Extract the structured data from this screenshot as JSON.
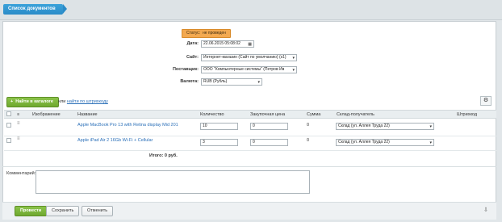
{
  "header": {
    "doc_list_tab": "Список документов"
  },
  "form": {
    "status_label": "Статус:",
    "status_value": "не проведен",
    "date_label": "Дата:",
    "date_value": "22.06.2015 05:08:02",
    "site_label": "Сайт:",
    "site_value": "Интернет-магазин (Сайт по умолчанию) (s1)",
    "supplier_label": "Поставщик:",
    "supplier_value": "ООО \"Компьютерные системы\" (Петров Ив",
    "currency_label": "Валюта:",
    "currency_value": "RUB (Рубль)"
  },
  "toolbar": {
    "find_catalog_label": "Найти в каталоге",
    "or_label": "или",
    "barcode_link": "найти по штрихкоду"
  },
  "table": {
    "columns": [
      "Изображение",
      "Название",
      "Количество",
      "Закупочная цена",
      "Сумма",
      "Склад-получатель",
      "Штрихкод"
    ],
    "rows": [
      {
        "name": "Apple MacBook Pro 13 with Retina display Mid 201",
        "quantity": "10",
        "price": "0",
        "sum": "0",
        "warehouse": "Склад (ул. Аллея Труда 22)"
      },
      {
        "name": "Apple iPad Air 2 16Gb Wi-Fi + Cellular",
        "quantity": "3",
        "price": "0",
        "sum": "0",
        "warehouse": "Склад (ул. Аллея Труда 22)"
      }
    ],
    "total": "Итого: 0 руб."
  },
  "comment": {
    "label": "Комментарий:"
  },
  "actions": {
    "post": "Провести",
    "save": "Сохранить",
    "cancel": "Отменить"
  }
}
